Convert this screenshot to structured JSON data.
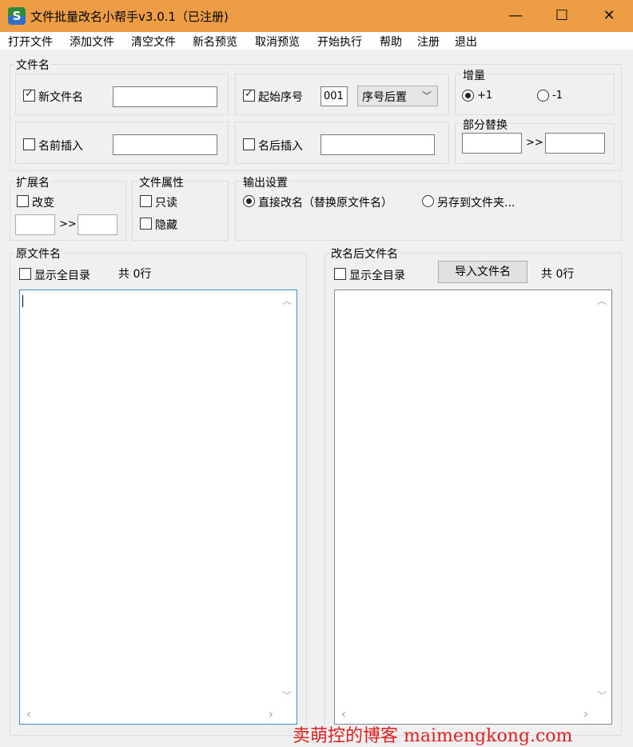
{
  "window": {
    "title": "文件批量改名小帮手v3.0.1（已注册)",
    "app_icon_glyph": "S",
    "minimize_glyph": "—",
    "maximize_glyph": "☐",
    "close_glyph": "✕",
    "titlebar_color": "#ed9e45"
  },
  "menu": {
    "open_file": "打开文件",
    "add_file": "添加文件",
    "clear_file": "清空文件",
    "preview_new": "新名预览",
    "cancel_preview": "取消预览",
    "execute": "开始执行",
    "help": "帮助",
    "register": "注册",
    "exit": "退出"
  },
  "filename_group": {
    "legend": "文件名",
    "new_name_label": "新文件名",
    "new_name_checked": true,
    "new_name_value": "",
    "start_seq_label": "起始序号",
    "start_seq_checked": true,
    "start_seq_value": "001",
    "seq_position": "序号后置",
    "prefix_label": "名前插入",
    "prefix_checked": false,
    "prefix_value": "",
    "suffix_label": "名后插入",
    "suffix_checked": false,
    "suffix_value": ""
  },
  "increment": {
    "legend": "增量",
    "plus_label": "+1",
    "minus_label": "-1",
    "selected": "+1"
  },
  "partial_replace": {
    "legend": "部分替换",
    "arrow": ">>",
    "from_value": "",
    "to_value": ""
  },
  "extension": {
    "legend": "扩展名",
    "change_label": "改变",
    "change_checked": false,
    "arrow": ">>",
    "from_value": "",
    "to_value": ""
  },
  "attributes": {
    "legend": "文件属性",
    "readonly_label": "只读",
    "hidden_label": "隐藏"
  },
  "output": {
    "legend": "输出设置",
    "rename_direct_label": "直接改名（替换原文件名）",
    "save_to_folder_label": "另存到文件夹...",
    "selected": "rename_direct"
  },
  "original_panel": {
    "legend": "原文件名",
    "show_full_dir_label": "显示全目录",
    "count_label": "共 0行"
  },
  "renamed_panel": {
    "legend": "改名后文件名",
    "show_full_dir_label": "显示全目录",
    "import_button": "导入文件名",
    "count_label": "共 0行"
  },
  "scroll_glyphs": {
    "up": "︿",
    "down": "﹀",
    "left": "‹",
    "right": "›"
  },
  "watermark": "卖萌控的博客  maimengkong.com"
}
